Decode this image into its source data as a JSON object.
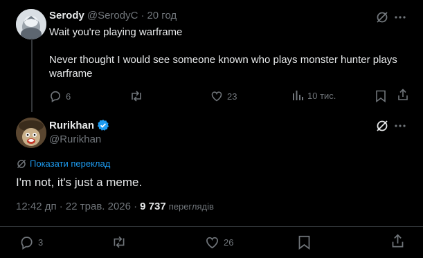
{
  "reply_tweet": {
    "display_name": "Serody",
    "handle": "@SerodyC",
    "separator": "·",
    "time": "20 год",
    "line1": "Wait you're playing warframe",
    "line2": "Never thought I would see someone known who plays monster hunter plays warframe",
    "replies": "6",
    "likes": "23",
    "views": "10 тис."
  },
  "main_tweet": {
    "display_name": "Rurikhan",
    "handle": "@Rurikhan",
    "translate_label": "Показати переклад",
    "text": "I'm not, it's just a meme.",
    "timestamp": "12:42 дп · 22 трав. 2026 ·",
    "views_count": "9 737",
    "views_label": "переглядів",
    "replies": "3",
    "likes": "26"
  },
  "colors": {
    "accent": "#1d9bf0",
    "muted": "#71767b",
    "text": "#e7e9ea"
  }
}
